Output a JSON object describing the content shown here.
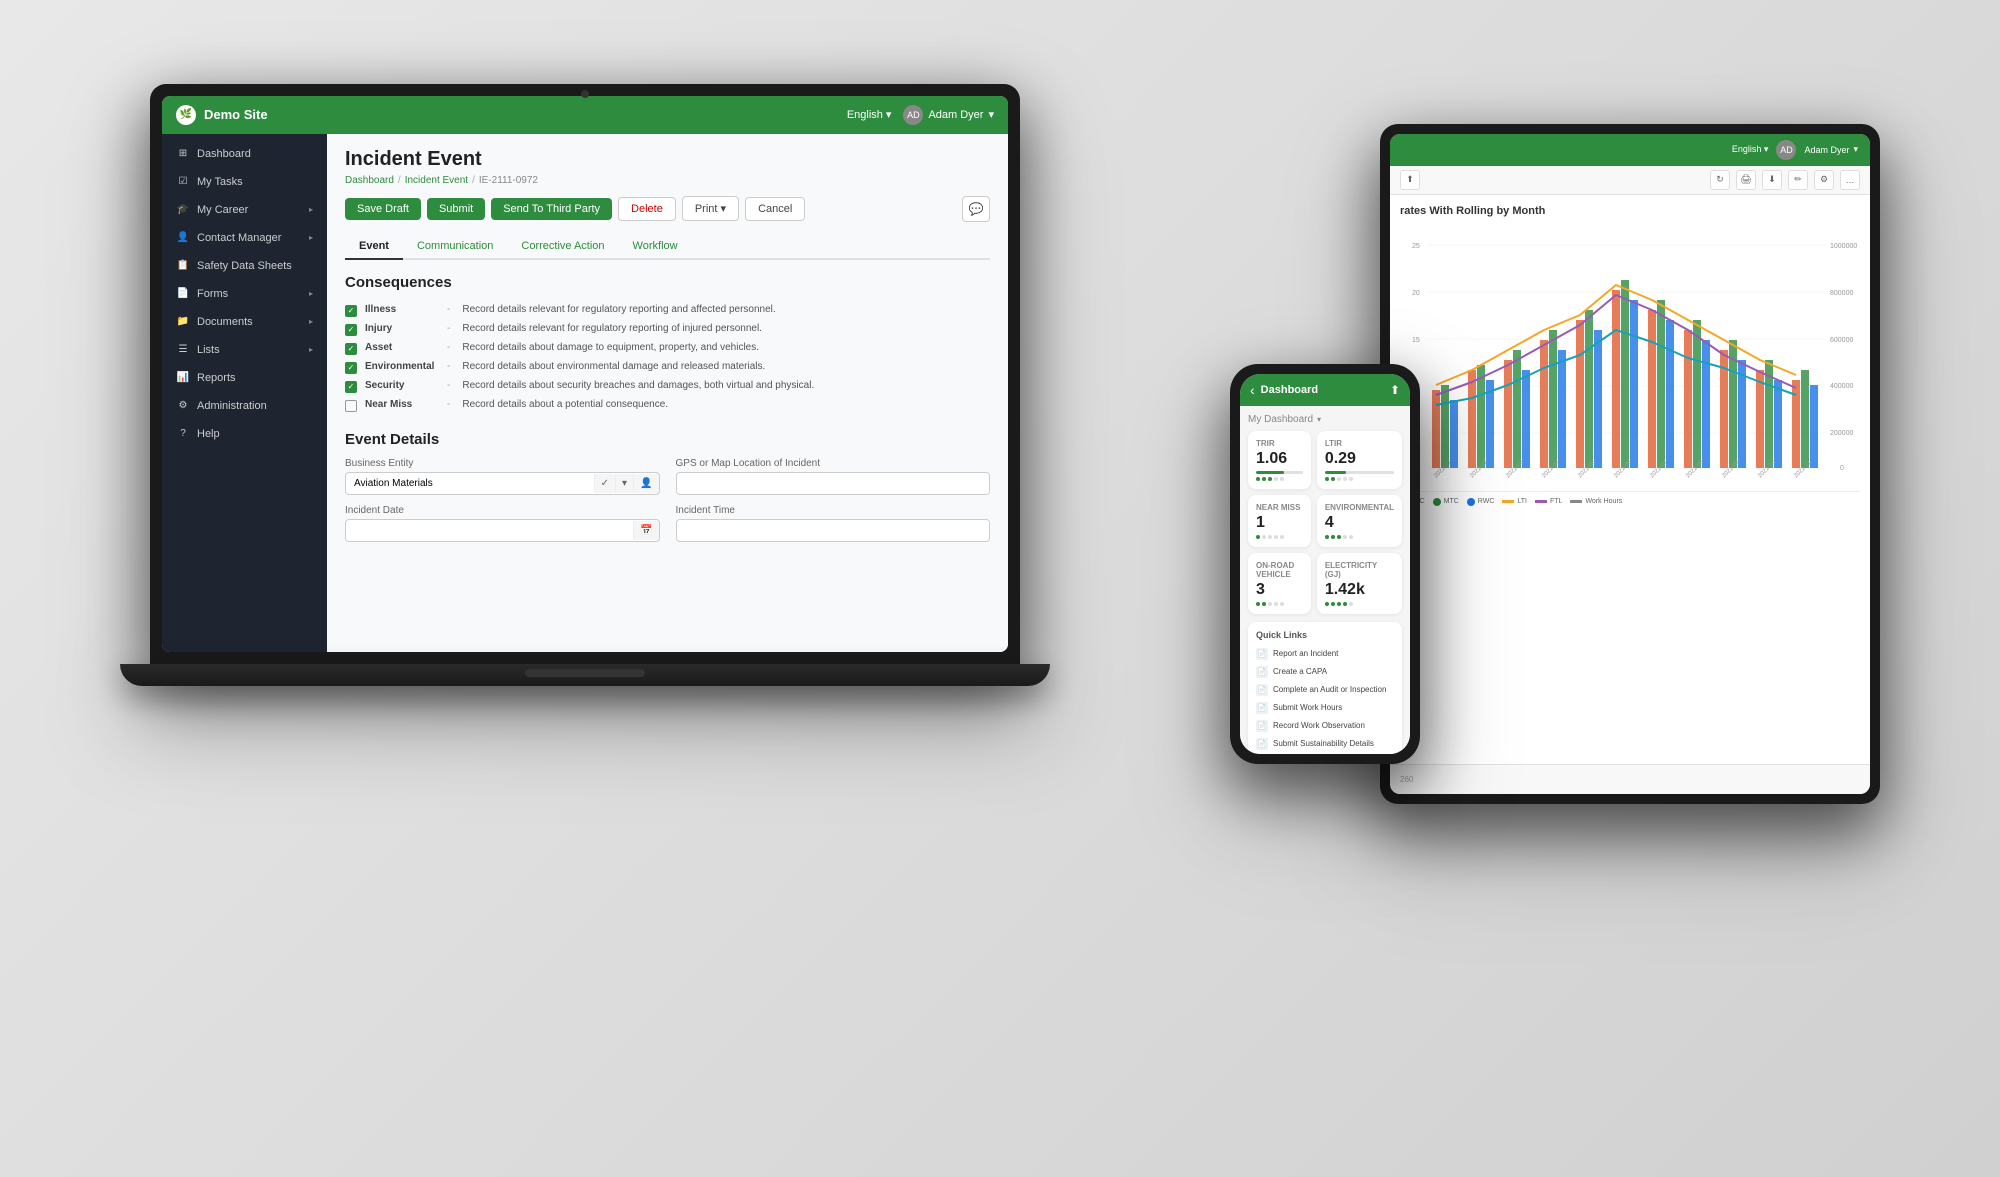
{
  "app": {
    "title": "Demo Site",
    "language": "English",
    "user": "Adam Dyer"
  },
  "sidebar": {
    "items": [
      {
        "label": "Dashboard",
        "icon": "⊞"
      },
      {
        "label": "My Tasks",
        "icon": "☑"
      },
      {
        "label": "My Career",
        "icon": "🎓",
        "hasArrow": true
      },
      {
        "label": "Contact Manager",
        "icon": "👤",
        "hasArrow": true
      },
      {
        "label": "Safety Data Sheets",
        "icon": "📋"
      },
      {
        "label": "Forms",
        "icon": "📄",
        "hasArrow": true
      },
      {
        "label": "Documents",
        "icon": "📁",
        "hasArrow": true
      },
      {
        "label": "Lists",
        "icon": "☰",
        "hasArrow": true
      },
      {
        "label": "Reports",
        "icon": "📊"
      },
      {
        "label": "Administration",
        "icon": "⚙"
      },
      {
        "label": "Help",
        "icon": "?"
      }
    ]
  },
  "page": {
    "title": "Incident Event",
    "breadcrumb": {
      "dashboard": "Dashboard",
      "event": "Incident Event",
      "id": "IE-2111-0972"
    }
  },
  "toolbar": {
    "save_draft": "Save Draft",
    "submit": "Submit",
    "send_to_third_party": "Send To Third Party",
    "delete": "Delete",
    "print": "Print",
    "cancel": "Cancel"
  },
  "tabs": [
    {
      "label": "Event",
      "active": true
    },
    {
      "label": "Communication",
      "active": false
    },
    {
      "label": "Corrective Action",
      "active": false
    },
    {
      "label": "Workflow",
      "active": false
    }
  ],
  "consequences": {
    "title": "Consequences",
    "items": [
      {
        "name": "Illness",
        "checked": true,
        "desc": "Record details relevant for regulatory reporting and affected personnel."
      },
      {
        "name": "Injury",
        "checked": true,
        "desc": "Record details relevant for regulatory reporting of injured personnel."
      },
      {
        "name": "Asset",
        "checked": true,
        "desc": "Record details about damage to equipment, property, and vehicles."
      },
      {
        "name": "Environmental",
        "checked": true,
        "desc": "Record details about environmental damage and released materials."
      },
      {
        "name": "Security",
        "checked": true,
        "desc": "Record details about security breaches and damages, both virtual and physical."
      },
      {
        "name": "Near Miss",
        "checked": false,
        "desc": "Record details about a potential consequence."
      }
    ]
  },
  "event_details": {
    "title": "Event Details",
    "business_entity_label": "Business Entity",
    "business_entity_value": "Aviation Materials",
    "gps_label": "GPS or Map Location of Incident",
    "incident_date_label": "Incident Date",
    "incident_time_label": "Incident Time"
  },
  "phone": {
    "header": "Dashboard",
    "section": "My Dashboard",
    "metrics": [
      {
        "label": "TRIR",
        "value": "1.06"
      },
      {
        "label": "LTIR",
        "value": "0.29"
      },
      {
        "label": "Near Miss",
        "value": "1"
      },
      {
        "label": "Environmental",
        "value": "4"
      },
      {
        "label": "On-Road Vehicle",
        "value": "3"
      },
      {
        "label": "Electricity (GJ)",
        "value": "1.42k"
      }
    ],
    "quick_links": {
      "title": "Quick Links",
      "items": [
        "Report an Incident",
        "Create a CAPA",
        "Complete an Audit or Inspection",
        "Submit Work Hours",
        "Record Work Observation",
        "Submit Sustainability Details"
      ]
    }
  },
  "tablet": {
    "language": "English",
    "user": "Adam Dyer",
    "chart_title": "rates With Rolling by Month",
    "legend": [
      {
        "color": "#e05c2e",
        "label": "FAC"
      },
      {
        "color": "#2d8c3e",
        "label": "MTC"
      },
      {
        "color": "#1a73e8",
        "label": "RWC"
      },
      {
        "color": "#f5a623",
        "label": "LTI"
      },
      {
        "color": "#9b59b6",
        "label": "FTL"
      },
      {
        "color": "#888",
        "label": "Work Hours"
      }
    ]
  }
}
